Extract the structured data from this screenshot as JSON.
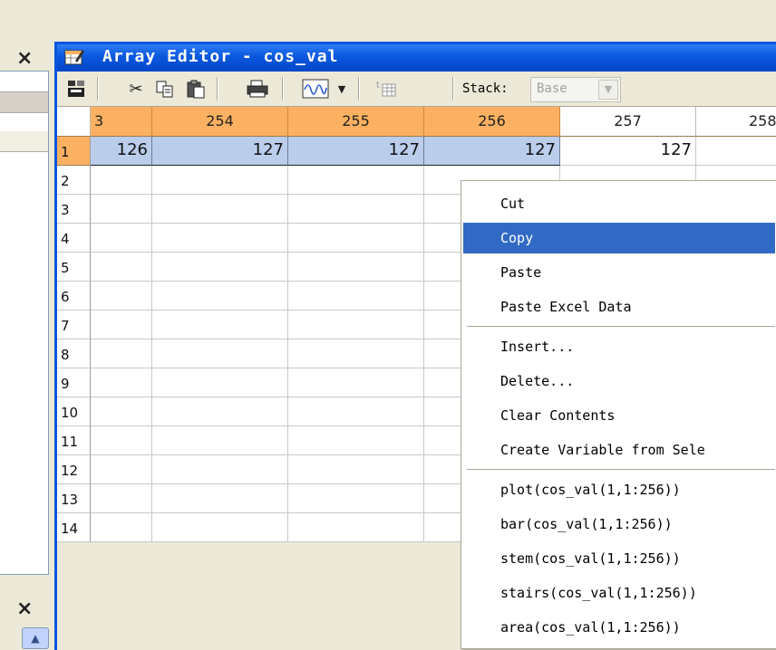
{
  "window": {
    "title": "Array Editor - cos_val",
    "icons": [
      "window-icon"
    ]
  },
  "toolbar": {
    "stack_label": "Stack:",
    "stack_value": "Base",
    "icons": [
      "import-data-icon",
      "cut-icon",
      "copy-icon",
      "paste-icon",
      "print-icon",
      "plot-selection-icon",
      "dropdown-arrow-icon",
      "insert-column-icon"
    ]
  },
  "grid": {
    "columns": [
      "3",
      "254",
      "255",
      "256",
      "257",
      "258"
    ],
    "rows": [
      "1",
      "2",
      "3",
      "4",
      "5",
      "6",
      "7",
      "8",
      "9",
      "10",
      "11",
      "12",
      "13",
      "14"
    ],
    "row1": [
      "126",
      "127",
      "127",
      "127",
      "127",
      ""
    ]
  },
  "context_menu": {
    "items": [
      "Cut",
      "Copy",
      "Paste",
      "Paste Excel Data",
      "Insert...",
      "Delete...",
      "Clear Contents",
      "Create Variable from Sele",
      "plot(cos_val(1,1:256))",
      "bar(cos_val(1,1:256))",
      "stem(cos_val(1,1:256))",
      "stairs(cos_val(1,1:256))",
      "area(cos_val(1,1:256))"
    ],
    "highlighted": "Copy"
  },
  "left_panel": {
    "close_glyph": "×",
    "scroll_up_glyph": "^"
  },
  "colors": {
    "titlebar": "#0A58DE",
    "header_selected": "#FBB161",
    "cell_selected": "#BACDEB",
    "menu_highlight": "#316AC5"
  }
}
